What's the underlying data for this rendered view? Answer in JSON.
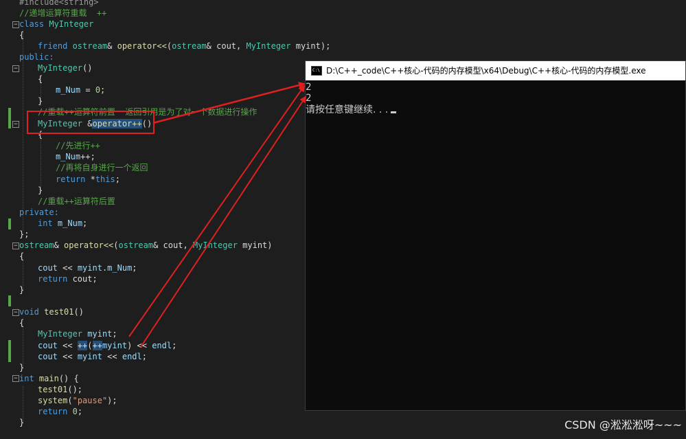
{
  "code": {
    "l0": "#include<string>",
    "l1": "//递增运算符重载  ++",
    "l2a": "class ",
    "l2b": "MyInteger",
    "l3": "{",
    "l4a": "friend ",
    "l4b": "ostream",
    "l4c": "& ",
    "l4d": "operator<<",
    "l4e": "(",
    "l4f": "ostream",
    "l4g": "& cout, ",
    "l4h": "MyInteger",
    "l4i": " myint);",
    "l5": "public:",
    "l6a": "MyInteger",
    "l6b": "()",
    "l7": "{",
    "l8a": "m_Num",
    "l8b": " = ",
    "l8c": "0",
    "l8d": ";",
    "l9": "}",
    "l10": "//重载++运算符前置  返回引用是为了对一个数据进行操作",
    "l11a": "MyInteger",
    "l11b": " &",
    "l11c": "operator++",
    "l11d": "()",
    "l12": "{",
    "l13": "//先进行++",
    "l14a": "m_Num",
    "l14b": "++;",
    "l15": "//再将自身进行一个返回",
    "l16a": "return",
    "l16b": " *",
    "l16c": "this",
    "l16d": ";",
    "l17": "}",
    "l18": "//重载++运算符后置",
    "l19": "private:",
    "l20a": "int",
    "l20b": " ",
    "l20c": "m_Num",
    "l20d": ";",
    "l21": "};",
    "l22a": "ostream",
    "l22b": "& ",
    "l22c": "operator<<",
    "l22d": "(",
    "l22e": "ostream",
    "l22f": "& cout, ",
    "l22g": "MyInteger",
    "l22h": " myint)",
    "l23": "{",
    "l24a": "cout",
    "l24b": " << ",
    "l24c": "myint",
    "l24d": ".",
    "l24e": "m_Num",
    "l24f": ";",
    "l25a": "return",
    "l25b": " cout;",
    "l26": "}",
    "l27a": "void",
    "l27b": " ",
    "l27c": "test01",
    "l27d": "()",
    "l28": "{",
    "l29a": "MyInteger",
    "l29b": " ",
    "l29c": "myint",
    "l29d": ";",
    "l30a": "cout",
    "l30b": " << ",
    "l30c": "++",
    "l30d": "(",
    "l30e": "++",
    "l30f": "myint",
    "l30g": ") << ",
    "l30h": "endl",
    "l30i": ";",
    "l31a": "cout",
    "l31b": " << ",
    "l31c": "myint",
    "l31d": " << ",
    "l31e": "endl",
    "l31f": ";",
    "l32": "}",
    "l33a": "int",
    "l33b": " ",
    "l33c": "main",
    "l33d": "() {",
    "l34a": "test01",
    "l34b": "();",
    "l35a": "system",
    "l35b": "(",
    "l35c": "\"pause\"",
    "l35d": ");",
    "l36a": "return",
    "l36b": " ",
    "l36c": "0",
    "l36d": ";",
    "l37": "}"
  },
  "console": {
    "title": "D:\\C++_code\\C++核心-代码的内存模型\\x64\\Debug\\C++核心-代码的内存模型.exe",
    "line1": "2",
    "line2": "2",
    "line3": "请按任意键继续. . ."
  },
  "watermark": "CSDN @淞淞淞呀~~~",
  "colors": {
    "editor_bg": "#1e1e1e",
    "keyword": "#569cd6",
    "type": "#4ec9b0",
    "comment": "#57a64a",
    "arrow": "#e02020"
  }
}
